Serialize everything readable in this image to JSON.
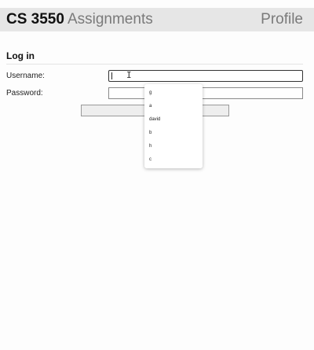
{
  "header": {
    "course": "CS 3550",
    "section": "Assignments",
    "profile_link": "Profile"
  },
  "login": {
    "title": "Log in",
    "username_label": "Username:",
    "username_value": "",
    "password_label": "Password:",
    "password_value": "",
    "submit_label": ""
  },
  "autocomplete": {
    "options": [
      "g",
      "a",
      "david",
      "b",
      "h",
      "c"
    ]
  },
  "icons": {
    "text_cursor": "I"
  }
}
